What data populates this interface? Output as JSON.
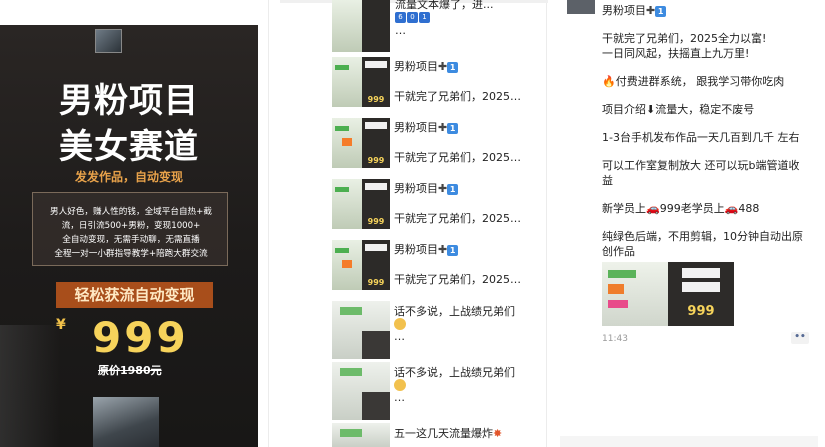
{
  "poster": {
    "title_line1": "男粉项目",
    "title_line2": "美女赛道",
    "subtitle": "发发作品，自动变现",
    "box_lines": [
      "男人好色，赚人性的钱，全域平台自热+截",
      "流，日引流500+男粉，变现1000+",
      "全自动变现，无需手动聊，无需直播",
      "全程一对一小群指导教学+陪跑大群交流"
    ],
    "banner": "轻松获流自动变现",
    "currency": "¥",
    "price": "999",
    "orig_label": "原价",
    "orig_price": "1980元"
  },
  "middle": {
    "top_partial": "流量文本爆了，进...",
    "top_partial2": "601",
    "top_ellipsis": "…",
    "items": [
      {
        "title": "男粉项目",
        "subtitle": "干就完了兄弟们，2025…",
        "thumb_price": "999"
      },
      {
        "title": "男粉项目",
        "subtitle": "干就完了兄弟们，2025…",
        "thumb_price": "999"
      },
      {
        "title": "男粉项目",
        "subtitle": "干就完了兄弟们，2025…",
        "thumb_price": "999"
      },
      {
        "title": "男粉项目",
        "subtitle": "干就完了兄弟们，2025…",
        "thumb_price": "999"
      }
    ],
    "chat_items": [
      {
        "text": "话不多说，上战绩兄弟们",
        "ellipsis": "…"
      },
      {
        "text": "话不多说，上战绩兄弟们",
        "ellipsis": "…"
      }
    ],
    "bottom_item": "五一这几天流量爆炸"
  },
  "right": {
    "title": "男粉项目",
    "lines": [
      "干就完了兄弟们，2025全力以富!",
      "一日同风起，扶摇直上九万里!",
      "付费进群系统， 跟我学习带你吃肉",
      "项目介绍⬇流量大，稳定不废号",
      "1-3台手机发布作品一天几百到几千 左右",
      "可以工作室复制放大 还可以玩b端管道收",
      "益",
      "新学员上🚗999老学员上🚗488",
      "纯绿色后端，不用剪辑，10分钟自动出原",
      "创作品"
    ],
    "image_price": "999",
    "time": "11:43",
    "more_label": "••"
  },
  "colors": {
    "accent": "#3d8be0",
    "poster_price": "#f6d35b",
    "banner": "#a84e1b",
    "link": "#576b95"
  }
}
